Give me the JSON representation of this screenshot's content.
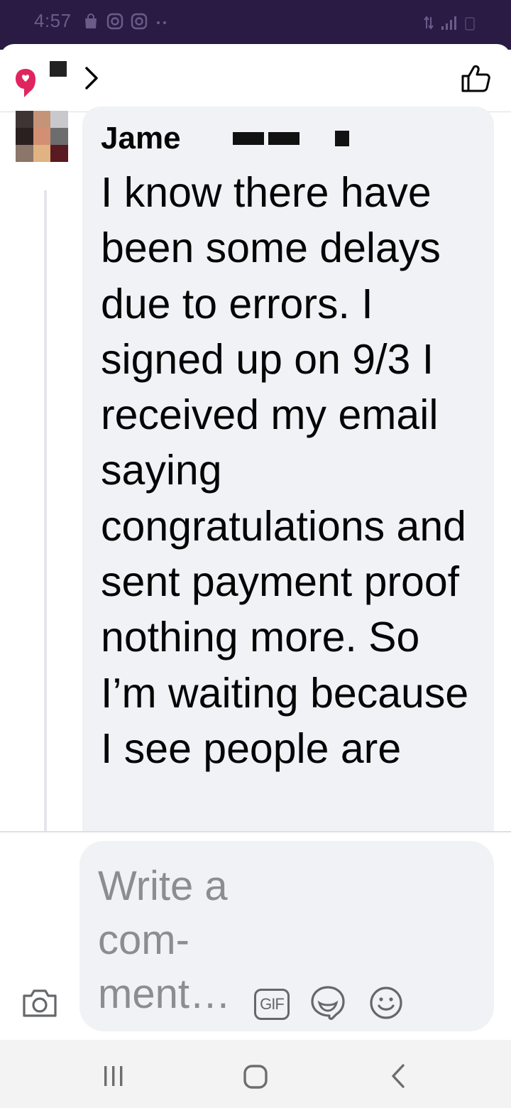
{
  "status_bar": {
    "time": "4:57",
    "left_icons": [
      "shopping-bag-icon",
      "instagram-icon",
      "instagram-icon",
      "more-dots-icon"
    ],
    "right_icons": [
      "data-transfer-icon",
      "signal-icon",
      "battery-icon"
    ]
  },
  "header": {
    "icons": [
      "group-logo-icon",
      "chevron-right-icon",
      "thumbs-up-icon"
    ]
  },
  "comment": {
    "author": "Jame",
    "text": "I know there have been some delays due to errors. I signed up on 9/3 I received my email saying congratulations and sent payment proof nothing more. So I’m waiting because I see people are"
  },
  "composer": {
    "placeholder": "Write a com-ment…",
    "gif_label": "GIF",
    "icons": [
      "camera-icon",
      "gif-icon",
      "sticker-icon",
      "emoji-icon"
    ]
  },
  "nav": {
    "icons": [
      "recent-apps-icon",
      "home-icon",
      "back-icon"
    ]
  },
  "colors": {
    "status_bar": "#2a1b45",
    "bubble": "#f0f2f5",
    "text": "#050505",
    "placeholder": "#8a8d91",
    "icon": "#65676b",
    "logo_red": "#e0245e"
  }
}
